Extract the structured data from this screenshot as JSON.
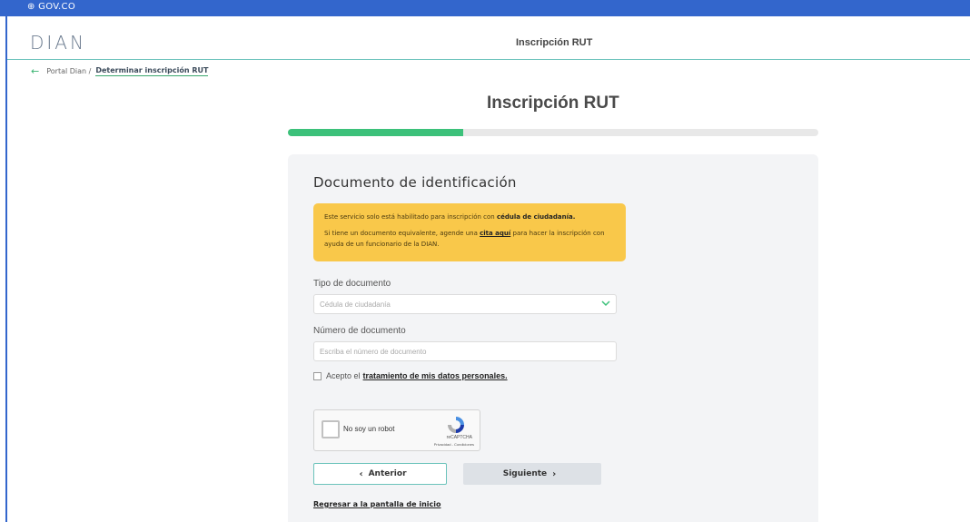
{
  "topbar": {
    "gov_label": "⊕ GOV.CO"
  },
  "header": {
    "logo_text": "DIAN",
    "title": "Inscripción RUT"
  },
  "breadcrumb": {
    "parent": "Portal Dian /",
    "current": "Determinar inscripción RUT"
  },
  "page_title": "Inscripción RUT",
  "progress": {
    "fraction": 0.33
  },
  "form": {
    "title": "Documento de identificación",
    "alert": {
      "line1_prefix": "Este servicio solo está habilitado para inscripción con ",
      "line1_bold": "cédula de ciudadanía.",
      "line2_prefix": "Si tiene un documento equivalente, agende una ",
      "line2_link": "cita aquí",
      "line2_suffix": " para hacer la inscripción con ayuda de un funcionario de la DIAN."
    },
    "doc_type_label": "Tipo de documento",
    "doc_type_value": "Cédula de ciudadanía",
    "doc_number_label": "Número de documento",
    "doc_number_placeholder": "Escriba el número de documento",
    "consent_prefix": "Acepto el",
    "consent_link": "tratamiento de mis datos personales.",
    "captcha": {
      "label": "No soy un robot",
      "brand": "reCAPTCHA",
      "links": "Privacidad - Condiciones"
    },
    "prev_label": "Anterior",
    "next_label": "Siguiente",
    "home_link": "Regresar a la pantalla de inicio"
  },
  "colors": {
    "topbar": "#3366cc",
    "progress": "#3cc17a",
    "alert": "#f9c84a",
    "accent": "#6bc3bb"
  }
}
